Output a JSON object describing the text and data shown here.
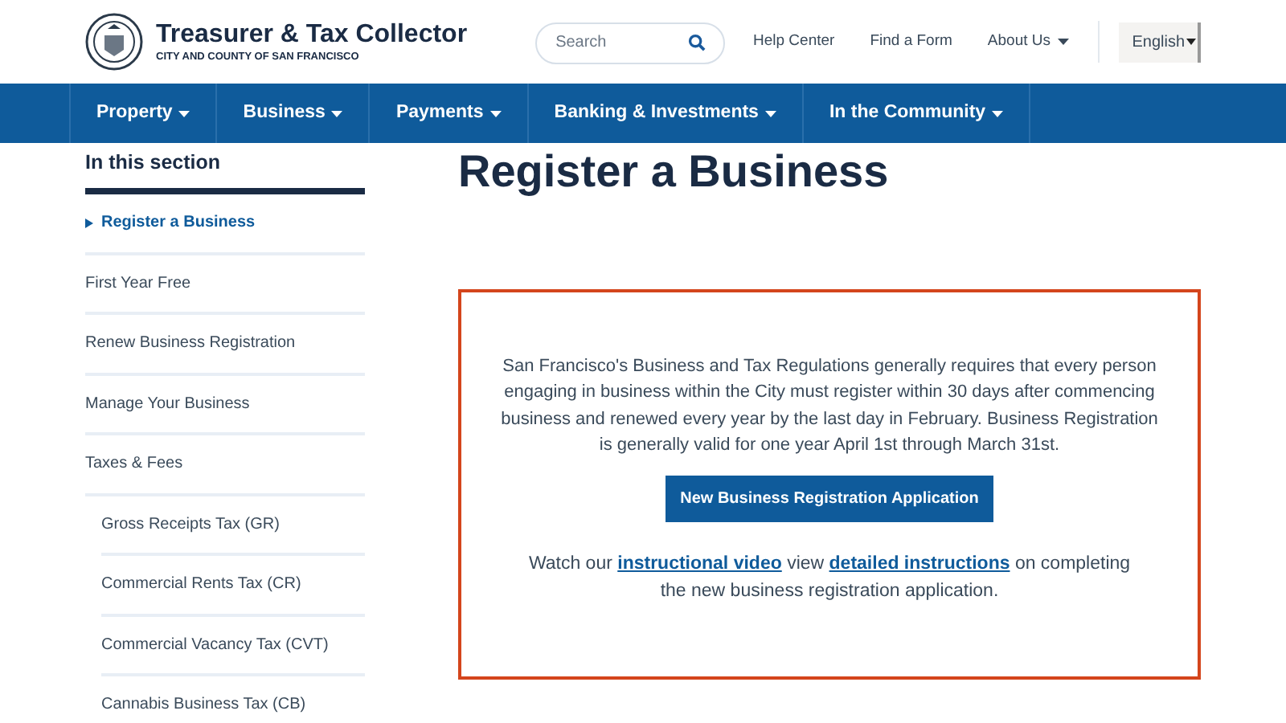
{
  "header": {
    "title": "Treasurer & Tax Collector",
    "subtitle": "CITY AND COUNTY OF SAN FRANCISCO",
    "search": {
      "placeholder": "Search"
    },
    "links": [
      {
        "label": "Help Center",
        "has_menu": false
      },
      {
        "label": "Find a Form",
        "has_menu": false
      },
      {
        "label": "About Us",
        "has_menu": true
      }
    ],
    "language": {
      "value": "English"
    }
  },
  "nav": [
    {
      "label": "Property"
    },
    {
      "label": "Business"
    },
    {
      "label": "Payments"
    },
    {
      "label": "Banking & Investments"
    },
    {
      "label": "In the Community"
    }
  ],
  "sidebar": {
    "heading": "In this section",
    "items": [
      {
        "label": "Register a Business",
        "selected": true
      },
      {
        "label": "First Year Free",
        "selected": false
      },
      {
        "label": "Renew Business Registration",
        "selected": false
      },
      {
        "label": "Manage Your Business",
        "selected": false
      },
      {
        "label": "Taxes & Fees",
        "selected": false,
        "children": [
          {
            "label": "Gross Receipts Tax (GR)",
            "selected": false
          },
          {
            "label": "Commercial Rents Tax (CR)",
            "selected": false
          },
          {
            "label": "Commercial Vacancy Tax (CVT)",
            "selected": false
          },
          {
            "label": "Cannabis Business Tax (CB)",
            "selected": false
          }
        ]
      }
    ]
  },
  "main": {
    "title": "Register a Business",
    "notice": {
      "paragraph": "San Francisco's Business and Tax Regulations generally requires that every person engaging in business within the City must register within 30 days after commencing business and renewed every year by the last day in February. Business Registration is generally valid for one year April 1st through March 31st.",
      "button": "New Business Registration Application",
      "footer": [
        {
          "kind": "text",
          "text": "Watch our "
        },
        {
          "kind": "link",
          "text": "instructional video"
        },
        {
          "kind": "text",
          "text": " view "
        },
        {
          "kind": "link",
          "text": "detailed instructions"
        },
        {
          "kind": "text",
          "text": " on completing the new business registration application."
        }
      ]
    }
  }
}
